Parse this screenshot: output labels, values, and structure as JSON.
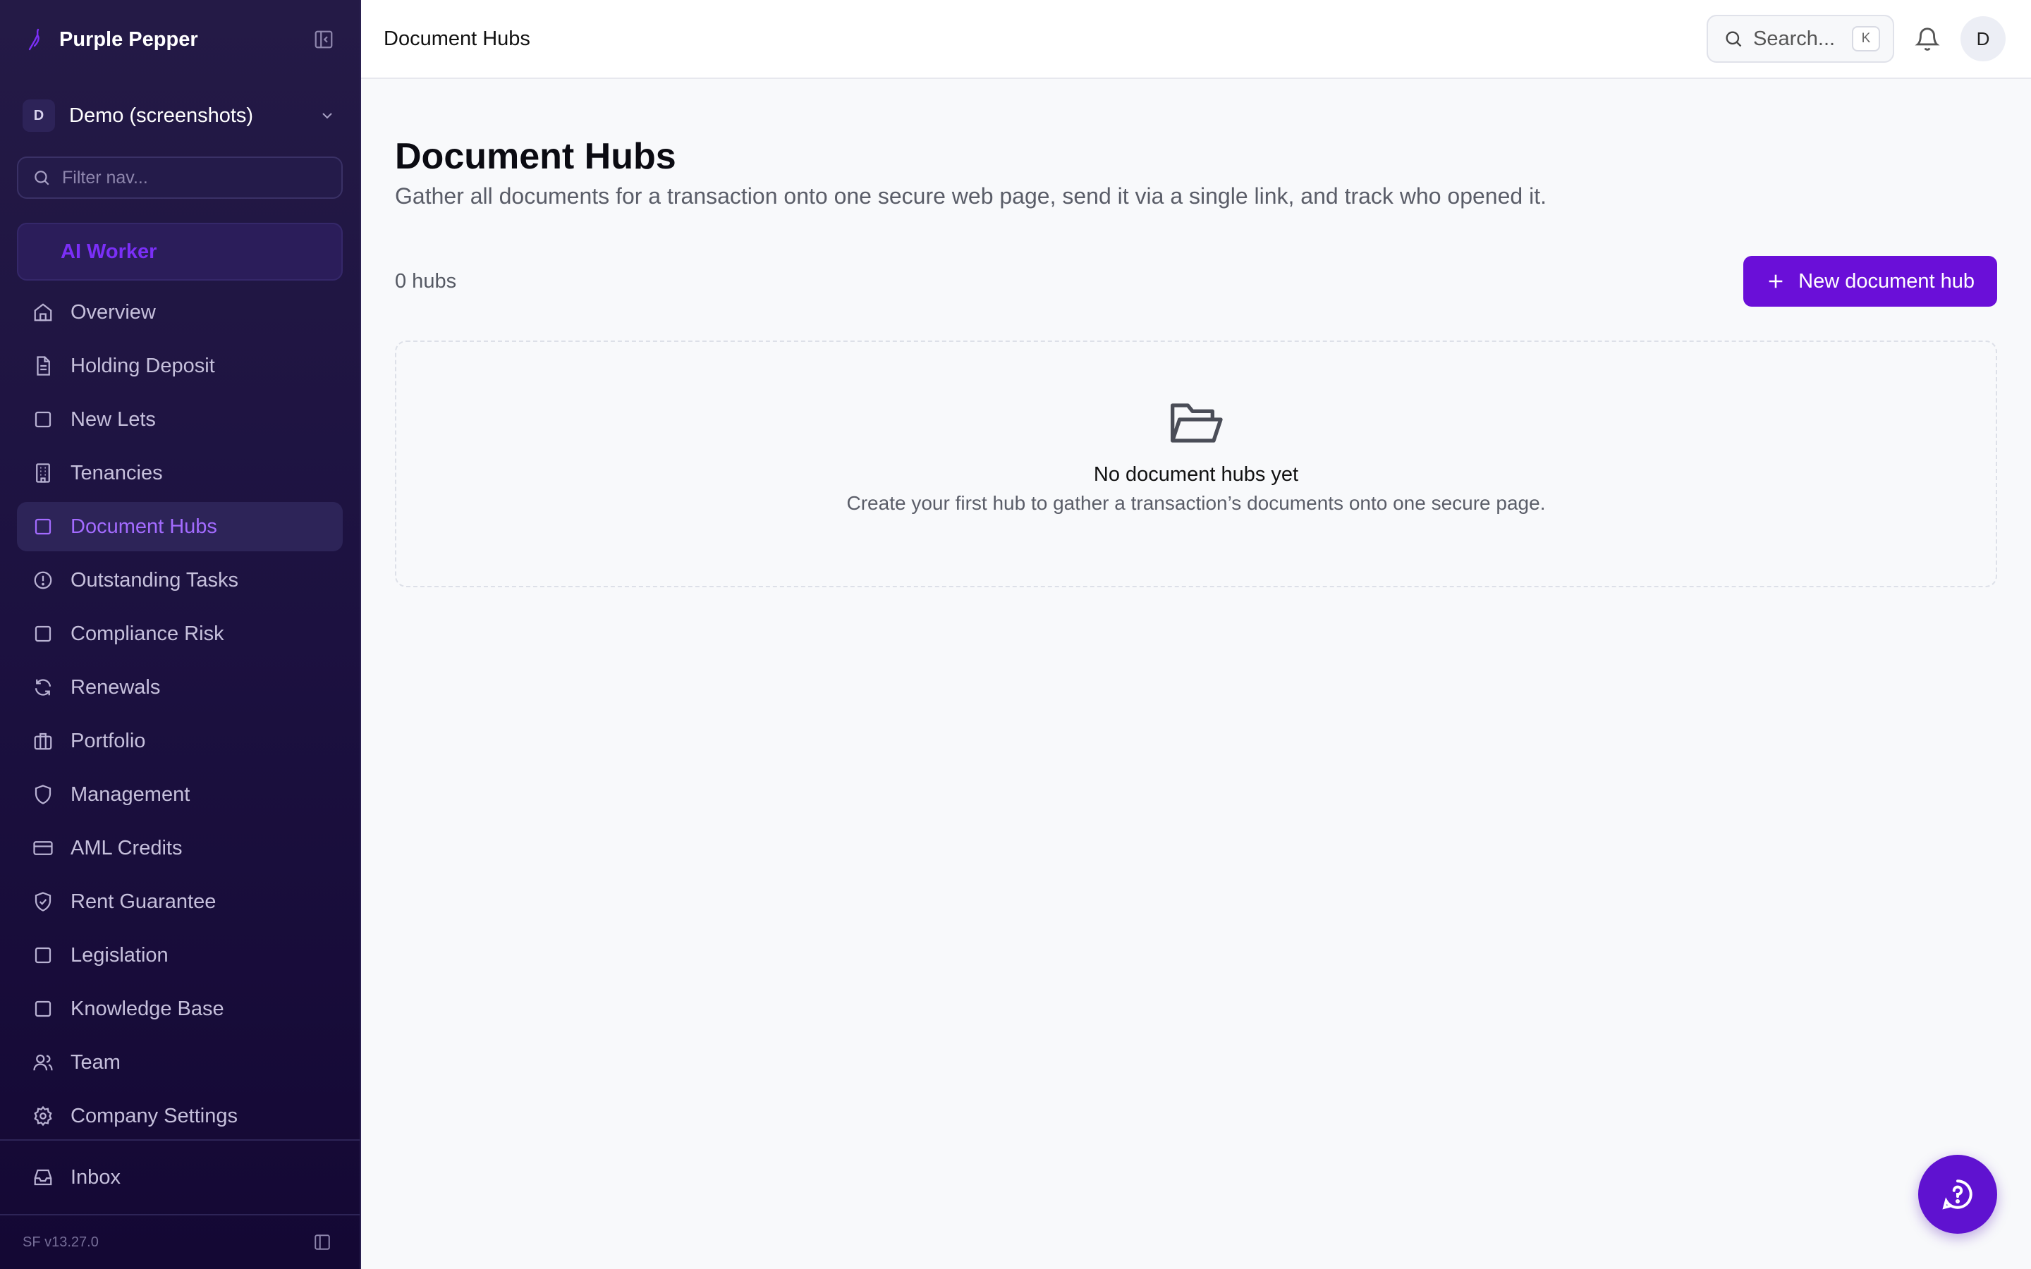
{
  "brand": {
    "name": "Purple Pepper",
    "accent": "#7b2ff7"
  },
  "workspace": {
    "initial": "D",
    "name": "Demo (screenshots)"
  },
  "sidebar": {
    "filter_placeholder": "Filter nav...",
    "ai_worker": "AI Worker",
    "items": [
      {
        "label": "Overview",
        "icon": "home-icon"
      },
      {
        "label": "Holding Deposit",
        "icon": "file-text-icon"
      },
      {
        "label": "New Lets",
        "icon": "square-icon"
      },
      {
        "label": "Tenancies",
        "icon": "building-icon"
      },
      {
        "label": "Document Hubs",
        "icon": "square-icon",
        "active": true
      },
      {
        "label": "Outstanding Tasks",
        "icon": "alert-circle-icon"
      },
      {
        "label": "Compliance Risk",
        "icon": "square-icon"
      },
      {
        "label": "Renewals",
        "icon": "refresh-icon"
      },
      {
        "label": "Portfolio",
        "icon": "briefcase-icon"
      },
      {
        "label": "Management",
        "icon": "shield-icon"
      },
      {
        "label": "AML Credits",
        "icon": "credit-card-icon"
      },
      {
        "label": "Rent Guarantee",
        "icon": "shield-check-icon"
      },
      {
        "label": "Legislation",
        "icon": "square-icon"
      },
      {
        "label": "Knowledge Base",
        "icon": "square-icon"
      },
      {
        "label": "Team",
        "icon": "users-icon"
      },
      {
        "label": "Company Settings",
        "icon": "gear-icon"
      }
    ],
    "inbox": "Inbox",
    "version": "SF v13.27.0"
  },
  "topbar": {
    "breadcrumb": "Document Hubs",
    "search_label": "Search...",
    "search_shortcut": "K",
    "avatar_initial": "D"
  },
  "main": {
    "title": "Document Hubs",
    "subtitle": "Gather all documents for a transaction onto one secure web page, send it via a single link, and track who opened it.",
    "count": "0 hubs",
    "new_button": "New document hub",
    "empty_title": "No document hubs yet",
    "empty_subtitle": "Create your first hub to gather a transaction’s documents onto one secure page."
  },
  "colors": {
    "primary_button": "#6a0fd8",
    "sidebar_bg": "#1c1140",
    "active_nav": "#a36bff"
  }
}
